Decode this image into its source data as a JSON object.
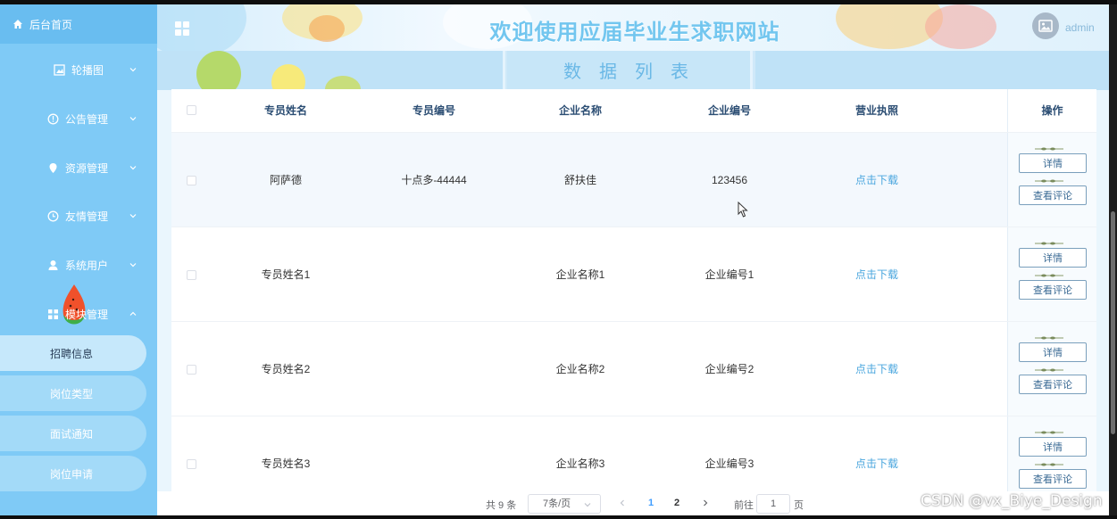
{
  "sidebar": {
    "home": "后台首页",
    "menus": [
      {
        "label": "轮播图",
        "icon": "image-icon"
      },
      {
        "label": "公告管理",
        "icon": "info-icon"
      },
      {
        "label": "资源管理",
        "icon": "location-icon"
      },
      {
        "label": "友情管理",
        "icon": "clock-icon"
      },
      {
        "label": "系统用户",
        "icon": "user-icon"
      },
      {
        "label": "模块管理",
        "icon": "grid-icon"
      }
    ],
    "submenus": [
      "招聘信息",
      "岗位类型",
      "面试通知",
      "岗位申请"
    ]
  },
  "header": {
    "title": "欢迎使用应届毕业生求职网站",
    "username": "admin"
  },
  "band": {
    "subtitle": "数据列表"
  },
  "table": {
    "columns": [
      "专员姓名",
      "专员编号",
      "企业名称",
      "企业编号",
      "营业执照",
      "操作"
    ],
    "rows": [
      {
        "name": "阿萨德",
        "code": "十点多-44444",
        "company": "舒扶佳",
        "company_code": "123456",
        "license": "点击下载"
      },
      {
        "name": "专员姓名1",
        "code": "",
        "company": "企业名称1",
        "company_code": "企业编号1",
        "license": "点击下载"
      },
      {
        "name": "专员姓名2",
        "code": "",
        "company": "企业名称2",
        "company_code": "企业编号2",
        "license": "点击下载"
      },
      {
        "name": "专员姓名3",
        "code": "",
        "company": "企业名称3",
        "company_code": "企业编号3",
        "license": "点击下载"
      }
    ],
    "actions": {
      "detail": "详情",
      "comments": "查看评论"
    }
  },
  "pager": {
    "total": "共 9 条",
    "page_size": "7条/页",
    "pages": [
      "1",
      "2"
    ],
    "current_page": "1",
    "goto_label": "前往",
    "goto_value": "1",
    "page_suffix": "页"
  },
  "watermark": "CSDN @vx_Biye_Design",
  "colors": {
    "sidebar": "#7fcaf6",
    "title": "#72c6ef",
    "link": "#4aa6de",
    "header_text": "#2b4d73"
  }
}
